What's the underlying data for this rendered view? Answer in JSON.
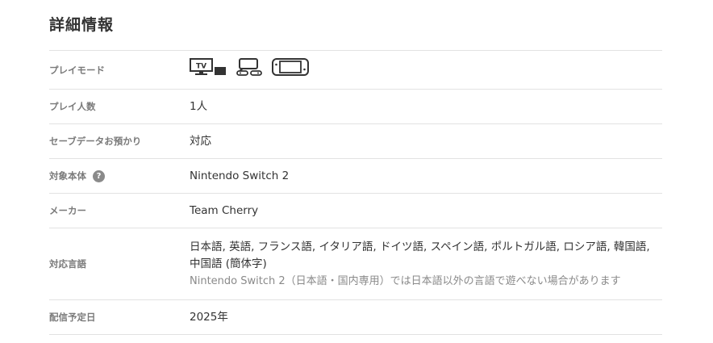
{
  "section": {
    "title": "詳細情報"
  },
  "rows": {
    "playmode": {
      "label": "プレイモード",
      "icons": [
        "tv-mode-icon",
        "tabletop-mode-icon",
        "handheld-mode-icon"
      ],
      "tv_text": "TV"
    },
    "players": {
      "label": "プレイ人数",
      "value": "1人"
    },
    "save": {
      "label": "セーブデータお預かり",
      "value": "対応"
    },
    "target": {
      "label": "対象本体",
      "help": "?",
      "value": "Nintendo Switch 2"
    },
    "maker": {
      "label": "メーカー",
      "value": "Team Cherry"
    },
    "languages": {
      "label": "対応言語",
      "line1": "日本語, 英語, フランス語, イタリア語, ドイツ語, スペイン語, ポルトガル語, ロシア語, 韓国語,",
      "line2": "中国語 (簡体字)",
      "note": "Nintendo Switch 2（日本語・国内専用）では日本語以外の言語で遊べない場合があります"
    },
    "release": {
      "label": "配信予定日",
      "value": "2025年"
    }
  },
  "colors": {
    "label": "#7a7a7a",
    "text": "#333333",
    "note": "#8a8a8a",
    "divider": "#e2e2e2",
    "help_badge": "#8a8a8a"
  }
}
